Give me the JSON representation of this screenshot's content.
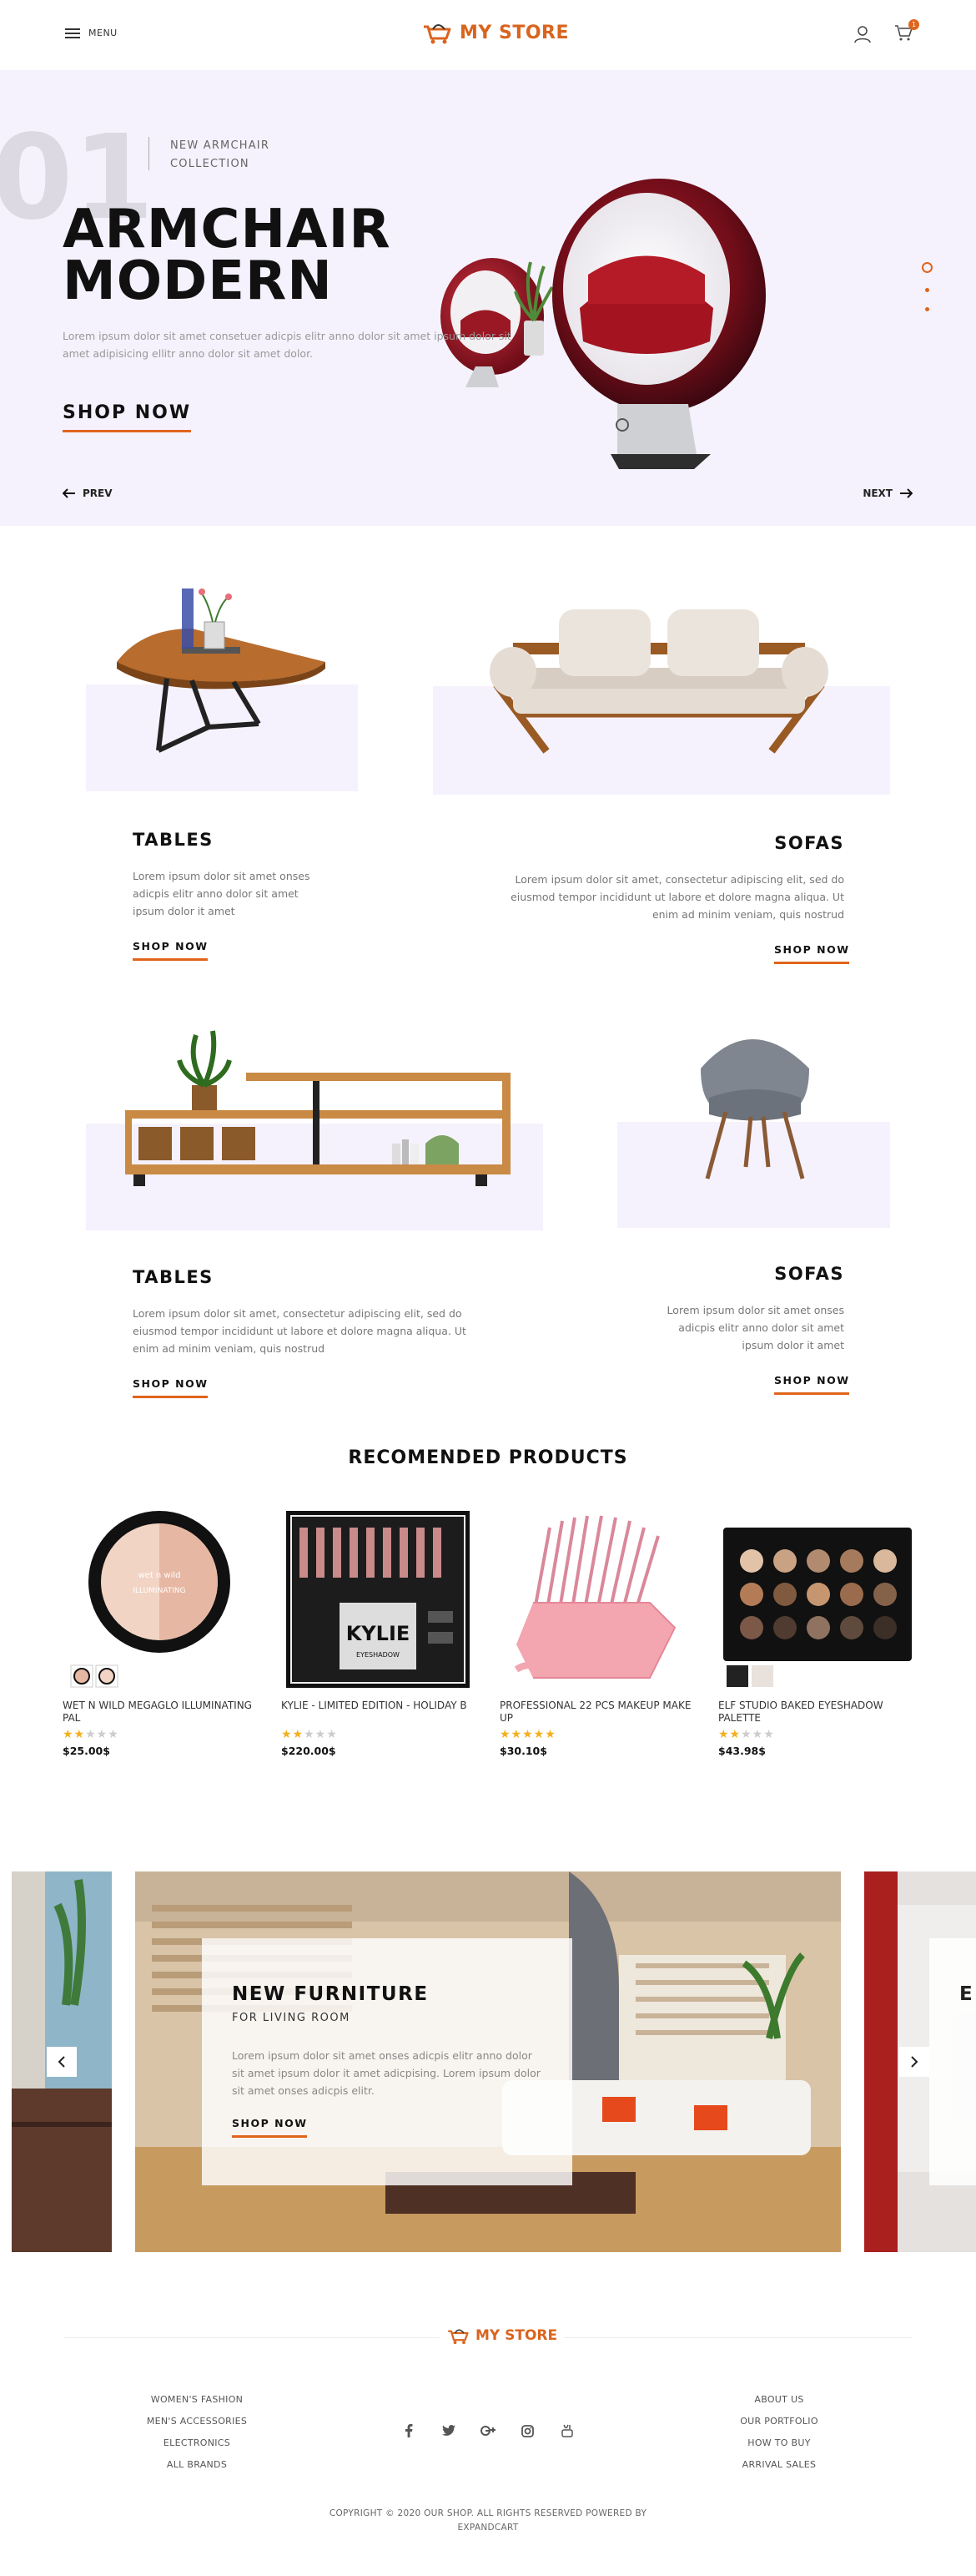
{
  "header": {
    "menu_label": "MENU",
    "logo_text": "MY STORE",
    "cart_count": "1"
  },
  "hero": {
    "number": "01",
    "subtitle_line1": "NEW ARMCHAIR",
    "subtitle_line2": "COLLECTION",
    "title_line1": "ARMCHAIR",
    "title_line2": "MODERN",
    "description": "Lorem ipsum dolor sit amet consetuer adicpis elitr anno dolor sit amet ipsum dolor sit amet adipisicing ellitr anno dolor sit amet dolor.",
    "cta": "SHOP NOW",
    "prev": "PREV",
    "next": "NEXT"
  },
  "categories": [
    {
      "title": "TABLES",
      "description": "Lorem ipsum dolor sit amet onses adicpis elitr anno dolor sit amet ipsum dolor it amet",
      "link": "SHOP NOW"
    },
    {
      "title": "SOFAS",
      "description": "Lorem ipsum dolor sit amet, consectetur adipiscing elit, sed do eiusmod tempor incididunt ut labore et dolore magna aliqua. Ut enim ad minim veniam, quis nostrud",
      "link": "SHOP NOW"
    },
    {
      "title": "TABLES",
      "description": "Lorem ipsum dolor sit amet, consectetur adipiscing elit, sed do eiusmod tempor incididunt ut labore et dolore magna aliqua. Ut enim ad minim veniam, quis nostrud",
      "link": "SHOP NOW"
    },
    {
      "title": "SOFAS",
      "description": "Lorem ipsum dolor sit amet onses adicpis elitr anno dolor sit amet ipsum dolor it amet",
      "link": "SHOP NOW"
    }
  ],
  "products_section": {
    "title": "RECOMENDED PRODUCTS",
    "items": [
      {
        "name": "WET N WILD MEGAGLO ILLUMINATING PAL",
        "rating": 2,
        "price": "$25.00$"
      },
      {
        "name": "KYLIE - LIMITED EDITION - HOLIDAY B",
        "rating": 2,
        "price": "$220.00$",
        "package_text": "KYLIE",
        "package_sub": "EYESHADOW"
      },
      {
        "name": "PROFESSIONAL 22 PCS MAKEUP MAKE UP",
        "rating": 5,
        "price": "$30.10$"
      },
      {
        "name": "ELF STUDIO BAKED EYESHADOW PALETTE",
        "rating": 2,
        "price": "$43.98$"
      }
    ]
  },
  "banner": {
    "title": "NEW FURNITURE",
    "subtitle": "FOR LIVING ROOM",
    "description": "Lorem ipsum dolor sit amet onses adicpis elitr anno dolor sit amet ipsum dolor it amet adicpising. Lorem ipsum dolor sit amet onses adicpis elitr.",
    "link": "SHOP NOW",
    "next_slide_letter": "E"
  },
  "footer": {
    "logo_text": "MY STORE",
    "left_links": [
      "WOMEN'S FASHION",
      "MEN'S ACCESSORIES",
      "ELECTRONICS",
      "ALL BRANDS"
    ],
    "right_links": [
      "ABOUT US",
      "OUR PORTFOLIO",
      "HOW TO BUY",
      "ARRIVAL SALES"
    ],
    "socials": [
      "facebook-icon",
      "twitter-icon",
      "google-plus-icon",
      "instagram-icon",
      "youtube-icon"
    ],
    "copyright_line1": "COPYRIGHT © 2020 OUR SHOP. ALL RIGHTS RESERVED POWERED BY",
    "copyright_line2": "EXPANDCART"
  },
  "colors": {
    "accent": "#e0641c",
    "hero_bg": "#f5f2fd",
    "star": "#f2b01e"
  }
}
